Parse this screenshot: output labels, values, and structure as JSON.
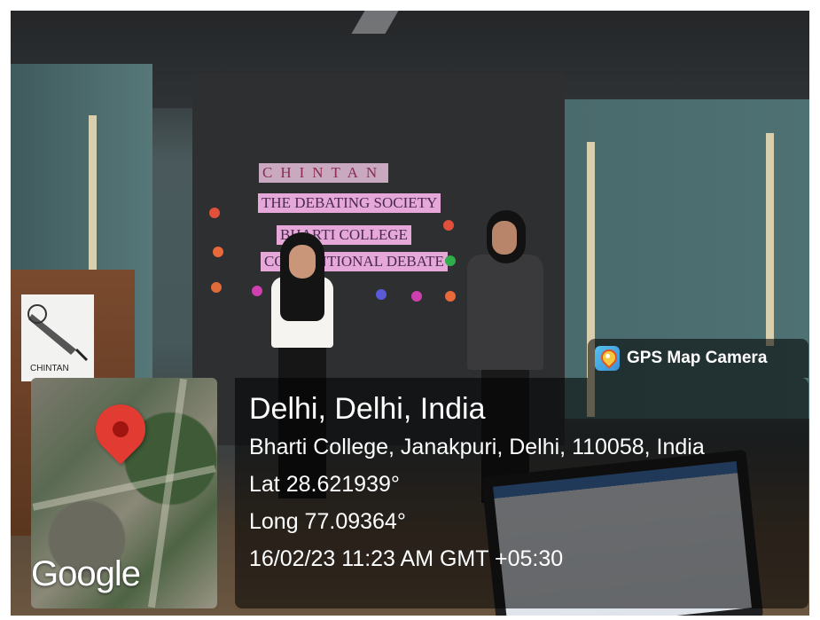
{
  "badge": {
    "label": "GPS Map Camera",
    "icon": "gps-map-camera-app-icon"
  },
  "map": {
    "watermark": "Google",
    "pin_icon": "location-pin-icon"
  },
  "location": {
    "city": "Delhi, Delhi, India",
    "address": "Bharti College, Janakpuri, Delhi, 110058, India",
    "lat": "Lat 28.621939°",
    "long": "Long 77.09364°",
    "datetime": "16/02/23 11:23 AM GMT +05:30"
  },
  "scene": {
    "banner_title": "CHINTAN",
    "banner_line1": "THE DEBATING SOCIETY",
    "banner_line2": "BHARTI COLLEGE",
    "banner_line3": "CONVENTIONAL DEBATE",
    "podium_logo_text": "CHINTAN"
  },
  "colors": {
    "overlay": "#000000",
    "pin": "#e23b31"
  }
}
